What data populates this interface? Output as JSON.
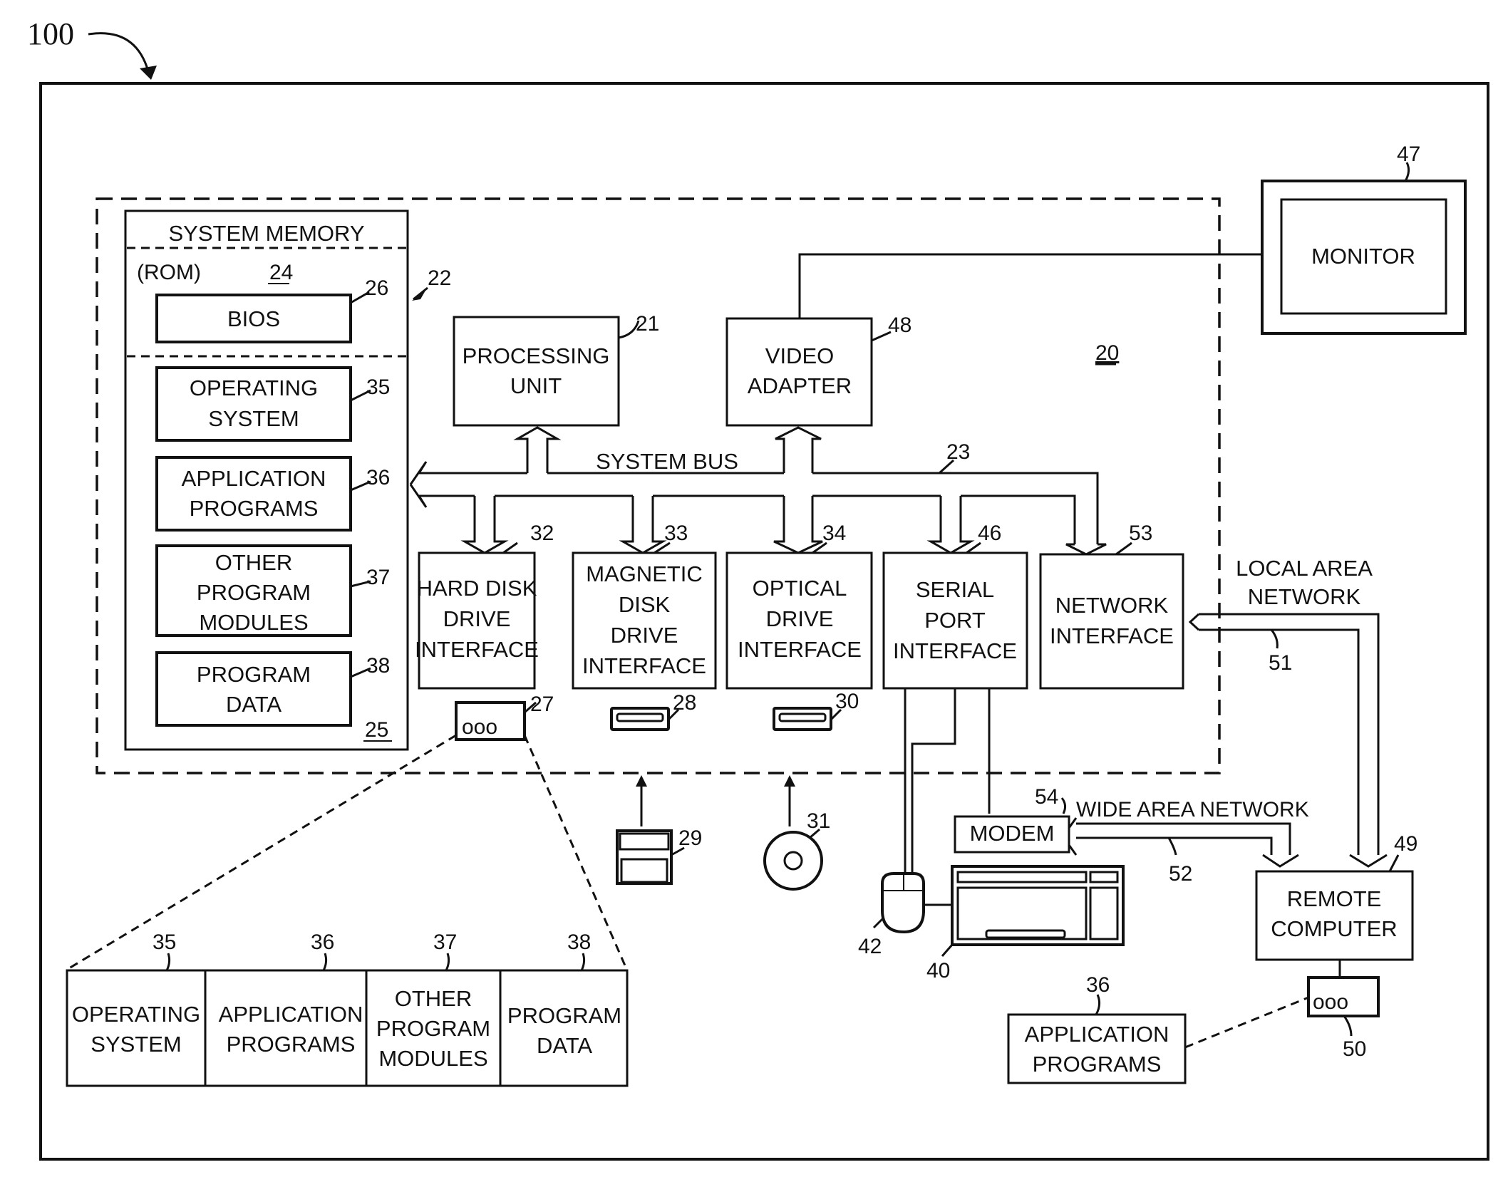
{
  "figure": {
    "number": "100",
    "computer_ref": "20"
  },
  "system_memory": {
    "title": "SYSTEM MEMORY",
    "ref": "22",
    "rom": {
      "label": "(ROM)",
      "ref": "24"
    },
    "ram_ref": "25",
    "bios": {
      "label": "BIOS",
      "ref": "26"
    },
    "items": [
      {
        "lines": [
          "OPERATING",
          "SYSTEM"
        ],
        "ref": "35"
      },
      {
        "lines": [
          "APPLICATION",
          "PROGRAMS"
        ],
        "ref": "36"
      },
      {
        "lines": [
          "OTHER",
          "PROGRAM",
          "MODULES"
        ],
        "ref": "37"
      },
      {
        "lines": [
          "PROGRAM",
          "DATA"
        ],
        "ref": "38"
      }
    ]
  },
  "processing_unit": {
    "lines": [
      "PROCESSING",
      "UNIT"
    ],
    "ref": "21"
  },
  "video_adapter": {
    "lines": [
      "VIDEO",
      "ADAPTER"
    ],
    "ref": "48"
  },
  "monitor": {
    "label": "MONITOR",
    "ref": "47"
  },
  "system_bus": {
    "label": "SYSTEM BUS",
    "ref": "23"
  },
  "interfaces": [
    {
      "lines": [
        "HARD DISK",
        "DRIVE",
        "INTERFACE"
      ],
      "ref": "32"
    },
    {
      "lines": [
        "MAGNETIC",
        "DISK",
        "DRIVE",
        "INTERFACE"
      ],
      "ref": "33"
    },
    {
      "lines": [
        "OPTICAL",
        "DRIVE",
        "INTERFACE"
      ],
      "ref": "34"
    },
    {
      "lines": [
        "SERIAL",
        "PORT",
        "INTERFACE"
      ],
      "ref": "46"
    },
    {
      "lines": [
        "NETWORK",
        "INTERFACE"
      ],
      "ref": "53"
    }
  ],
  "devices": {
    "hard_disk": {
      "ref": "27",
      "glyph": "ooo"
    },
    "magnetic_drive": {
      "ref": "28"
    },
    "optical_drive": {
      "ref": "30"
    },
    "floppy_disk": {
      "ref": "29"
    },
    "optical_disk": {
      "ref": "31"
    },
    "mouse": {
      "ref": "42"
    },
    "keyboard": {
      "ref": "40"
    },
    "modem": {
      "label": "MODEM",
      "ref": "54"
    }
  },
  "networks": {
    "lan": {
      "lines": [
        "LOCAL AREA",
        "NETWORK"
      ],
      "ref": "51"
    },
    "wan": {
      "label": "WIDE AREA NETWORK",
      "ref": "52"
    }
  },
  "remote_computer": {
    "lines": [
      "REMOTE",
      "COMPUTER"
    ],
    "ref": "49",
    "storage": {
      "ref": "50",
      "glyph": "ooo"
    },
    "app_programs": {
      "lines": [
        "APPLICATION",
        "PROGRAMS"
      ],
      "ref": "36"
    }
  },
  "expanded_storage": [
    {
      "lines": [
        "OPERATING",
        "SYSTEM"
      ],
      "ref": "35"
    },
    {
      "lines": [
        "APPLICATION",
        "PROGRAMS"
      ],
      "ref": "36"
    },
    {
      "lines": [
        "OTHER",
        "PROGRAM",
        "MODULES"
      ],
      "ref": "37"
    },
    {
      "lines": [
        "PROGRAM",
        "DATA"
      ],
      "ref": "38"
    }
  ]
}
